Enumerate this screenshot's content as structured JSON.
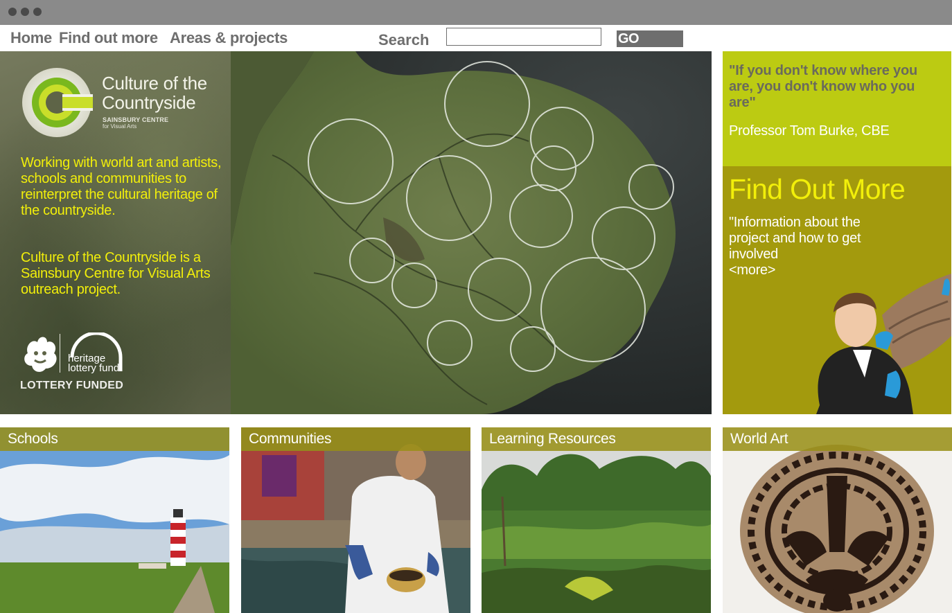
{
  "window": {
    "dots": 3
  },
  "nav": {
    "home": "Home",
    "find_out_more": "Find out more",
    "areas_projects": "Areas & projects",
    "search_label": "Search",
    "search_value": "",
    "go_label": "GO"
  },
  "hero": {
    "logo_title_line1": "Culture of the",
    "logo_title_line2": "Countryside",
    "logo_sub1": "SAINSBURY CENTRE",
    "logo_sub2": "for Visual Arts",
    "intro": "Working with world art and artists, schools and communities to reinterpret the cultural heritage of the countryside.",
    "intro2": "Culture of the Countryside is a Sainsbury Centre for Visual Arts outreach project.",
    "hlf_line1": "heritage",
    "hlf_line2": "lottery fund",
    "lottery_funded": "LOTTERY FUNDED"
  },
  "quote": {
    "text": "\"If you don't know where you are, you don't know who you are\"",
    "author": "Professor Tom Burke, CBE"
  },
  "find_out_more": {
    "title": "Find Out More",
    "description": "\"Information about the project and how to get involved",
    "more_link": "<more>"
  },
  "tiles": [
    {
      "label": "Schools"
    },
    {
      "label": "Communities"
    },
    {
      "label": "Learning Resources"
    },
    {
      "label": "World Art"
    }
  ],
  "colors": {
    "accent_yellow": "#f2ef0a",
    "lime": "#bccb12",
    "olive": "#a39a0d",
    "nav_gray": "#6e6e6e"
  }
}
